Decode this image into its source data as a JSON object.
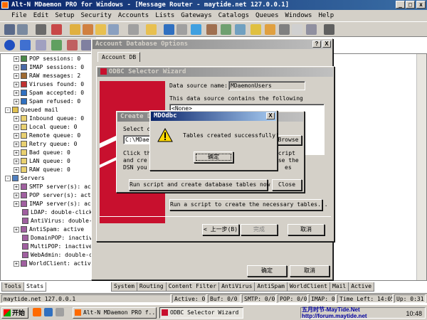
{
  "app": {
    "title": "Alt-N MDaemon PRO for Windows - [Message Router - maytide.net 127.0.0.1]",
    "menus": [
      "File",
      "Edit",
      "Setup",
      "Security",
      "Accounts",
      "Lists",
      "Gateways",
      "Catalogs",
      "Queues",
      "Windows",
      "Help"
    ]
  },
  "sidebar": {
    "tree": [
      {
        "label": "POP sessions: 0",
        "icon": "pop-icon",
        "expander": "+",
        "indent": 2
      },
      {
        "label": "IMAP sessions: 0",
        "icon": "imap-icon",
        "expander": "+",
        "indent": 2
      },
      {
        "label": "RAW messages: 2",
        "icon": "raw-icon",
        "expander": "+",
        "indent": 2
      },
      {
        "label": "Viruses found: 0",
        "icon": "virus-icon",
        "expander": "+",
        "indent": 2
      },
      {
        "label": "Spam accepted: 0",
        "icon": "spam-icon",
        "expander": "+",
        "indent": 2
      },
      {
        "label": "Spam refused: 0",
        "icon": "spam-icon",
        "expander": "+",
        "indent": 2
      },
      {
        "label": "Queued mail",
        "icon": "queue-folder-icon",
        "expander": "-",
        "indent": 1
      },
      {
        "label": "Inbound queue: 0",
        "icon": "queue-icon",
        "expander": "+",
        "indent": 2
      },
      {
        "label": "Local queue: 0",
        "icon": "queue-icon",
        "expander": "+",
        "indent": 2
      },
      {
        "label": "Remote queue: 0",
        "icon": "queue-icon",
        "expander": "+",
        "indent": 2
      },
      {
        "label": "Retry queue: 0",
        "icon": "queue-icon",
        "expander": "+",
        "indent": 2
      },
      {
        "label": "Bad queue: 0",
        "icon": "queue-icon",
        "expander": "+",
        "indent": 2
      },
      {
        "label": "LAN queue: 0",
        "icon": "queue-icon",
        "expander": "+",
        "indent": 2
      },
      {
        "label": "RAW queue: 0",
        "icon": "queue-icon",
        "expander": "+",
        "indent": 2
      },
      {
        "label": "Servers",
        "icon": "servers-folder-icon",
        "expander": "-",
        "indent": 1
      },
      {
        "label": "SMTP server(s): act",
        "icon": "server-icon",
        "expander": "+",
        "indent": 2
      },
      {
        "label": "POP server(s): acti",
        "icon": "server-icon",
        "expander": "+",
        "indent": 2
      },
      {
        "label": "IMAP server(s): act",
        "icon": "server-icon",
        "expander": "+",
        "indent": 2
      },
      {
        "label": "LDAP: double-click",
        "icon": "server-icon",
        "expander": "",
        "indent": 2
      },
      {
        "label": "AntiVirus: double-c",
        "icon": "server-icon",
        "expander": "",
        "indent": 2
      },
      {
        "label": "AntiSpam: active",
        "icon": "server-icon",
        "expander": "+",
        "indent": 2
      },
      {
        "label": "DomainPOP: inactive",
        "icon": "server-icon",
        "expander": "",
        "indent": 2
      },
      {
        "label": "MultiPOP: inactive",
        "icon": "server-icon",
        "expander": "",
        "indent": 2
      },
      {
        "label": "WebAdmin: double-cl",
        "icon": "server-icon",
        "expander": "",
        "indent": 2
      },
      {
        "label": "WorldClient: active",
        "icon": "server-icon",
        "expander": "+",
        "indent": 2
      }
    ],
    "bottom_tabs": [
      "Tools",
      "Stats"
    ],
    "active_bottom_tab": "Stats"
  },
  "main_tabs": [
    "System",
    "Routing",
    "Content Filter",
    "AntiVirus",
    "AntiSpam",
    "WorldClient",
    "Mail",
    "Active"
  ],
  "account_db_dialog": {
    "title": "Account Database Options",
    "help_btn": "?",
    "close_btn": "X",
    "tab": "Account DB",
    "ok": "确定",
    "cancel": "取消"
  },
  "odbc_wizard": {
    "title": "ODBC Selector Wizard",
    "ds_label": "Data source name:",
    "ds_value": "MDaemonUsers",
    "contains_text": "This data source contains the following",
    "list_item": "<None>",
    "run_script_btn": "Run a script to create the necessary tables...",
    "back_btn": "< 上一步(B)",
    "finish_btn": "完成",
    "cancel_btn": "取消"
  },
  "create_db_dialog": {
    "title": "Create D",
    "select_label": "Select d",
    "path_value": "C:\\MDaem",
    "browse_btn": "Browse",
    "help_line1": "Click th",
    "help_line2": "and cre",
    "help_line3": "DSN you",
    "help_right1": "script",
    "help_right2": "use the",
    "help_right3": "es",
    "run_btn": "Run script and create database tables now",
    "close_btn": "Close"
  },
  "msgbox": {
    "title": "MDOdbc",
    "message": "Tables created successfully!",
    "ok": "确定",
    "close_btn": "X"
  },
  "statusbar": {
    "host": "maytide.net 127.0.0.1",
    "active": "Active: 0",
    "buf": "Buf: 0/0",
    "smtp": "SMTP: 0/0",
    "pop": "POP: 0/0",
    "imap": "IMAP: 0",
    "time_left": "Time Left: 14:05",
    "up": "Up: 0:31"
  },
  "taskbar": {
    "start": "开始",
    "tasks": [
      "Alt-N MDaemon PRO f...",
      "ODBC Selector Wizard"
    ],
    "watermark1": "五月时节-MayTide.Net",
    "watermark2": "http://forum.maytide.net",
    "clock": "10:48"
  }
}
